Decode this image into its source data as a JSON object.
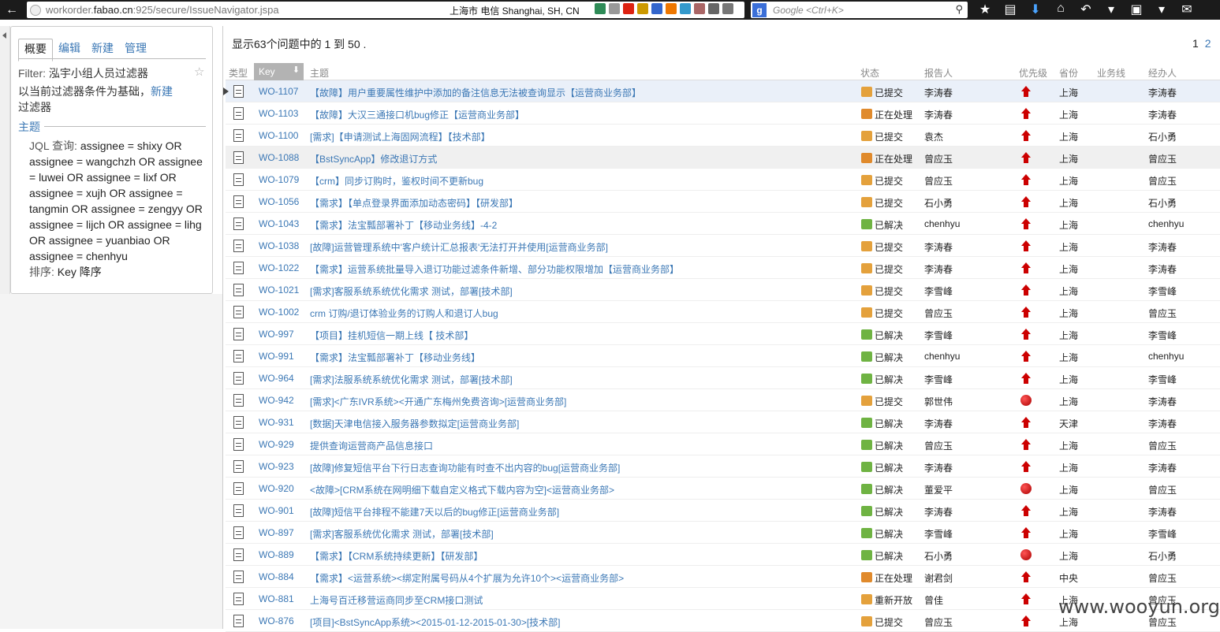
{
  "browser": {
    "url_prefix": "workorder.",
    "url_host": "fabao.cn",
    "url_rest": ":925/secure/IssueNavigator.jspa",
    "geo": "上海市 电信    Shanghai, SH, CN",
    "search_placeholder": "Google <Ctrl+K>",
    "search_engine_letter": "g"
  },
  "left": {
    "tabs": [
      "概要",
      "编辑",
      "新建",
      "管理"
    ],
    "filter_label": "Filter:",
    "filter_name": "泓宇小组人员过滤器",
    "base_text": "以当前过滤器条件为基础，",
    "base_link": "新建",
    "base_suffix": "过滤器",
    "section_title": "主题",
    "jql_label": "JQL 查询:",
    "jql_query": "assignee = shixy OR assignee = wangchzh OR assignee = luwei OR assignee = lixf OR assignee = xujh OR assignee = tangmin OR assignee = zengyy OR assignee = lijch OR assignee = lihg OR assignee = yuanbiao OR assignee = chenhyu",
    "sort_label": "排序:",
    "sort_value": "Key 降序"
  },
  "main": {
    "summary_text": "显示63个问题中的 1 到 50 .",
    "pages": [
      "1",
      "2"
    ],
    "columns": {
      "type": "类型",
      "key": "Key",
      "summary": "主题",
      "status": "状态",
      "reporter": "报告人",
      "priority": "优先级",
      "province": "省份",
      "bizline": "业务线",
      "assignee": "经办人"
    },
    "rows": [
      {
        "key": "WO-1107",
        "summary": "【故障】用户重要属性维护中添加的备注信息无法被查询显示【运营商业务部】",
        "status": "已提交",
        "status_kind": "submitted",
        "reporter": "李涛春",
        "priority": "up",
        "province": "上海",
        "assignee": "李涛春"
      },
      {
        "key": "WO-1103",
        "summary": "【故障】大汉三通接口机bug修正【运营商业务部】",
        "status": "正在处理",
        "status_kind": "progress",
        "reporter": "李涛春",
        "priority": "up",
        "province": "上海",
        "assignee": "李涛春"
      },
      {
        "key": "WO-1100",
        "summary": "[需求]【申请测试上海固网流程】【技术部】",
        "status": "已提交",
        "status_kind": "submitted",
        "reporter": "袁杰",
        "priority": "up",
        "province": "上海",
        "assignee": "石小勇"
      },
      {
        "key": "WO-1088",
        "summary": "【BstSyncApp】修改退订方式",
        "status": "正在处理",
        "status_kind": "progress",
        "reporter": "曾应玉",
        "priority": "up",
        "province": "上海",
        "assignee": "曾应玉"
      },
      {
        "key": "WO-1079",
        "summary": "【crm】同步订购时，鉴权时间不更新bug",
        "status": "已提交",
        "status_kind": "submitted",
        "reporter": "曾应玉",
        "priority": "up",
        "province": "上海",
        "assignee": "曾应玉"
      },
      {
        "key": "WO-1056",
        "summary": "【需求】【单点登录界面添加动态密码】【研发部】",
        "status": "已提交",
        "status_kind": "submitted",
        "reporter": "石小勇",
        "priority": "up",
        "province": "上海",
        "assignee": "石小勇"
      },
      {
        "key": "WO-1043",
        "summary": "【需求】法宝瓢部署补丁【移动业务线】-4-2",
        "status": "已解决",
        "status_kind": "resolved",
        "reporter": "chenhyu",
        "priority": "up",
        "province": "上海",
        "assignee": "chenhyu"
      },
      {
        "key": "WO-1038",
        "summary": "[故障]运营管理系统中'客户统计汇总报表'无法打开并使用[运营商业务部]",
        "status": "已提交",
        "status_kind": "submitted",
        "reporter": "李涛春",
        "priority": "up",
        "province": "上海",
        "assignee": "李涛春"
      },
      {
        "key": "WO-1022",
        "summary": "【需求】运营系统批量导入退订功能过滤条件新增、部分功能权限增加【运营商业务部】",
        "status": "已提交",
        "status_kind": "submitted",
        "reporter": "李涛春",
        "priority": "up",
        "province": "上海",
        "assignee": "李涛春"
      },
      {
        "key": "WO-1021",
        "summary": "[需求]客服系统系统优化需求 测试，部署[技术部]",
        "status": "已提交",
        "status_kind": "submitted",
        "reporter": "李雪峰",
        "priority": "up",
        "province": "上海",
        "assignee": "李雪峰"
      },
      {
        "key": "WO-1002",
        "summary": "crm 订购/退订体验业务的订购人和退订人bug",
        "status": "已提交",
        "status_kind": "submitted",
        "reporter": "曾应玉",
        "priority": "up",
        "province": "上海",
        "assignee": "曾应玉"
      },
      {
        "key": "WO-997",
        "summary": "【项目】挂机短信一期上线【 技术部】",
        "status": "已解决",
        "status_kind": "resolved",
        "reporter": "李雪峰",
        "priority": "up",
        "province": "上海",
        "assignee": "李雪峰"
      },
      {
        "key": "WO-991",
        "summary": "【需求】法宝瓢部署补丁【移动业务线】",
        "status": "已解决",
        "status_kind": "resolved",
        "reporter": "chenhyu",
        "priority": "up",
        "province": "上海",
        "assignee": "chenhyu"
      },
      {
        "key": "WO-964",
        "summary": "[需求]法服系统系统优化需求 测试，部署[技术部]",
        "status": "已解决",
        "status_kind": "resolved",
        "reporter": "李雪峰",
        "priority": "up",
        "province": "上海",
        "assignee": "李雪峰"
      },
      {
        "key": "WO-942",
        "summary": "[需求]<广东IVR系统><开通广东梅州免费咨询>[运营商业务部]",
        "status": "已提交",
        "status_kind": "submitted",
        "reporter": "郭世伟",
        "priority": "dot",
        "province": "上海",
        "assignee": "李涛春"
      },
      {
        "key": "WO-931",
        "summary": "[数据]天津电信接入服务器参数拟定[运营商业务部]",
        "status": "已解决",
        "status_kind": "resolved",
        "reporter": "李涛春",
        "priority": "up",
        "province": "天津",
        "assignee": "李涛春"
      },
      {
        "key": "WO-929",
        "summary": "提供查询运营商产品信息接口",
        "status": "已解决",
        "status_kind": "resolved",
        "reporter": "曾应玉",
        "priority": "up",
        "province": "上海",
        "assignee": "曾应玉"
      },
      {
        "key": "WO-923",
        "summary": "[故障]修复短信平台下行日志查询功能有时查不出内容的bug[运营商业务部]",
        "status": "已解决",
        "status_kind": "resolved",
        "reporter": "李涛春",
        "priority": "up",
        "province": "上海",
        "assignee": "李涛春"
      },
      {
        "key": "WO-920",
        "summary": "<故障>[CRM系统在网明细下载自定义格式下载内容为空]<运营商业务部>",
        "status": "已解决",
        "status_kind": "resolved",
        "reporter": "董爱平",
        "priority": "dot",
        "province": "上海",
        "assignee": "曾应玉"
      },
      {
        "key": "WO-901",
        "summary": "[故障]短信平台排程不能建7天以后的bug修正[运营商业务部]",
        "status": "已解决",
        "status_kind": "resolved",
        "reporter": "李涛春",
        "priority": "up",
        "province": "上海",
        "assignee": "李涛春"
      },
      {
        "key": "WO-897",
        "summary": "[需求]客服系统优化需求 测试，部署[技术部]",
        "status": "已解决",
        "status_kind": "resolved",
        "reporter": "李雪峰",
        "priority": "up",
        "province": "上海",
        "assignee": "李雪峰"
      },
      {
        "key": "WO-889",
        "summary": "【需求】【CRM系统持续更新】【研发部】",
        "status": "已解决",
        "status_kind": "resolved",
        "reporter": "石小勇",
        "priority": "dot",
        "province": "上海",
        "assignee": "石小勇"
      },
      {
        "key": "WO-884",
        "summary": "【需求】<运营系统><绑定附属号码从4个扩展为允许10个><运营商业务部>",
        "status": "正在处理",
        "status_kind": "progress",
        "reporter": "谢君剑",
        "priority": "up",
        "province": "中央",
        "assignee": "曾应玉"
      },
      {
        "key": "WO-881",
        "summary": "上海号百迁移营运商同步至CRM接口测试",
        "status": "重新开放",
        "status_kind": "reopen",
        "reporter": "曾佳",
        "priority": "up",
        "province": "上海",
        "assignee": "曾应玉"
      },
      {
        "key": "WO-876",
        "summary": "[项目]<BstSyncApp系统><2015-01-12-2015-01-30>[技术部]",
        "status": "已提交",
        "status_kind": "submitted",
        "reporter": "曾应玉",
        "priority": "up",
        "province": "上海",
        "assignee": "曾应玉"
      }
    ]
  },
  "watermark": "www.wooyun.org"
}
